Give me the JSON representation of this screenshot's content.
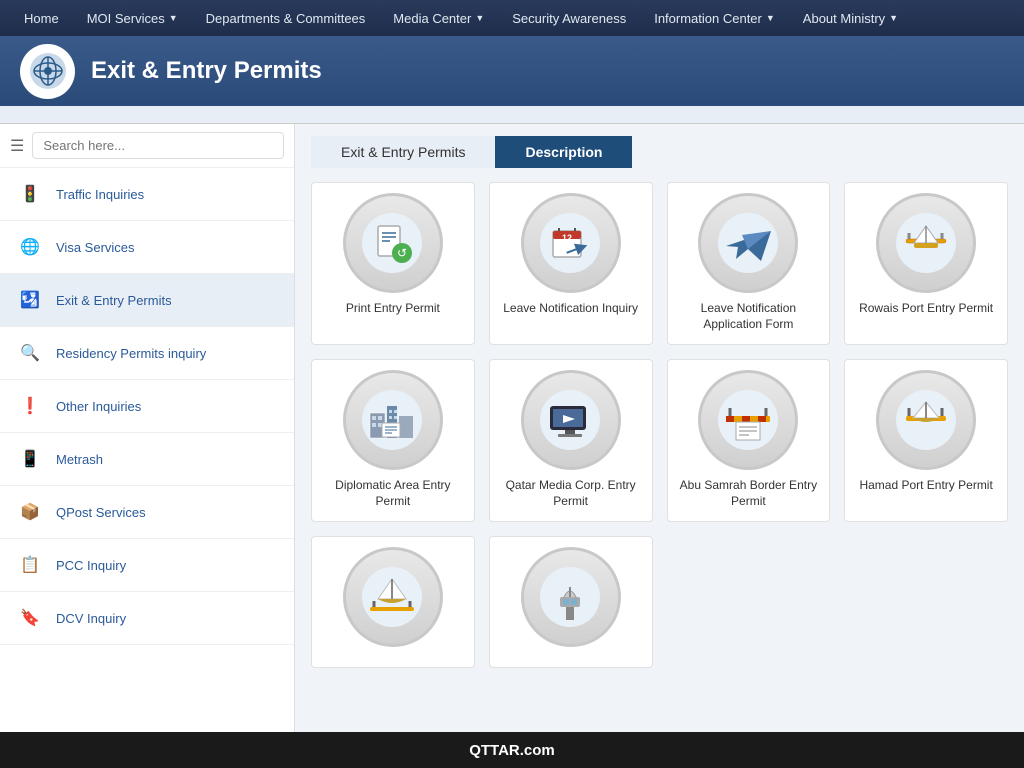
{
  "nav": {
    "items": [
      {
        "label": "Home",
        "has_arrow": false
      },
      {
        "label": "MOI Services",
        "has_arrow": true
      },
      {
        "label": "Departments & Committees",
        "has_arrow": false
      },
      {
        "label": "Media Center",
        "has_arrow": true
      },
      {
        "label": "Security Awareness",
        "has_arrow": false
      },
      {
        "label": "Information Center",
        "has_arrow": true
      },
      {
        "label": "About Ministry",
        "has_arrow": true
      }
    ]
  },
  "header": {
    "title": "Exit & Entry Permits"
  },
  "sidebar": {
    "search_placeholder": "Search here...",
    "items": [
      {
        "label": "Traffic Inquiries",
        "icon": "🚦",
        "active": false
      },
      {
        "label": "Visa Services",
        "icon": "🌐",
        "active": false
      },
      {
        "label": "Exit & Entry Permits",
        "icon": "🛂",
        "active": true
      },
      {
        "label": "Residency Permits inquiry",
        "icon": "🔍",
        "active": false
      },
      {
        "label": "Other Inquiries",
        "icon": "❗",
        "active": false
      },
      {
        "label": "Metrash",
        "icon": "📱",
        "active": false
      },
      {
        "label": "QPost Services",
        "icon": "📦",
        "active": false
      },
      {
        "label": "PCC Inquiry",
        "icon": "📋",
        "active": false
      },
      {
        "label": "DCV Inquiry",
        "icon": "🔖",
        "active": false
      }
    ]
  },
  "tabs": [
    {
      "label": "Exit & Entry Permits",
      "active": false
    },
    {
      "label": "Description",
      "active": true
    }
  ],
  "services": [
    {
      "label": "Print Entry Permit",
      "icon_type": "permit"
    },
    {
      "label": "Leave Notification Inquiry",
      "icon_type": "calendar"
    },
    {
      "label": "Leave Notification Application Form",
      "icon_type": "plane"
    },
    {
      "label": "Rowais Port Entry Permit",
      "icon_type": "port"
    },
    {
      "label": "Diplomatic Area Entry Permit",
      "icon_type": "diplomatic"
    },
    {
      "label": "Qatar Media Corp. Entry Permit",
      "icon_type": "media"
    },
    {
      "label": "Abu Samrah Border Entry Permit",
      "icon_type": "border"
    },
    {
      "label": "Hamad Port Entry Permit",
      "icon_type": "hamad"
    },
    {
      "label": "",
      "icon_type": "gate"
    },
    {
      "label": "",
      "icon_type": "tower"
    }
  ],
  "footer": {
    "text": "QTTAR.com"
  }
}
